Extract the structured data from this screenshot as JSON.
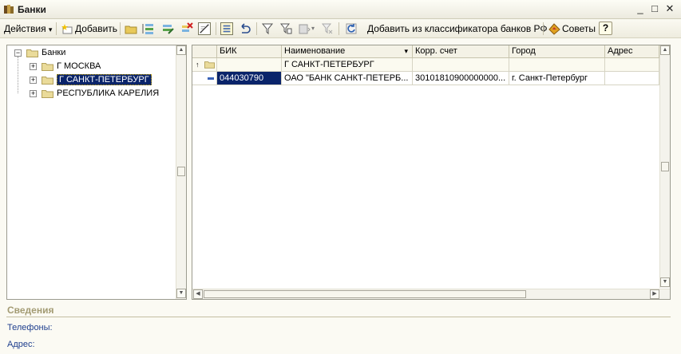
{
  "window": {
    "title": "Банки",
    "minimize": "_",
    "maximize": "□",
    "close": "✕"
  },
  "toolbar": {
    "actions_label": "Действия",
    "actions_arrow": "▾",
    "add_label": "Добавить",
    "add_from_classifier_label": "Добавить из классификатора банков РФ",
    "tips_label": "Советы",
    "help_label": "?"
  },
  "tree": {
    "root": "Банки",
    "items": [
      {
        "label": "Г МОСКВА",
        "selected": false
      },
      {
        "label": "Г САНКТ-ПЕТЕРБУРГ",
        "selected": true
      },
      {
        "label": "РЕСПУБЛИКА КАРЕЛИЯ",
        "selected": false
      }
    ]
  },
  "grid": {
    "columns": {
      "bik": "БИК",
      "name": "Наименование",
      "name_sort": "▾",
      "corr": "Корр. счет",
      "city": "Город",
      "address": "Адрес"
    },
    "group_row": {
      "marker": "↑",
      "name": "Г САНКТ-ПЕТЕРБУРГ"
    },
    "rows": [
      {
        "bik": "044030790",
        "name": "ОАО \"БАНК САНКТ-ПЕТЕРБ...",
        "corr": "30101810900000000...",
        "city": "г. Санкт-Петербург",
        "address": ""
      }
    ]
  },
  "details": {
    "title": "Сведения",
    "phones_label": "Телефоны:",
    "address_label": "Адрес:"
  },
  "colors": {
    "selection": "#0a246a",
    "label_blue": "#1f3f8e",
    "section_title": "#a39b73"
  }
}
